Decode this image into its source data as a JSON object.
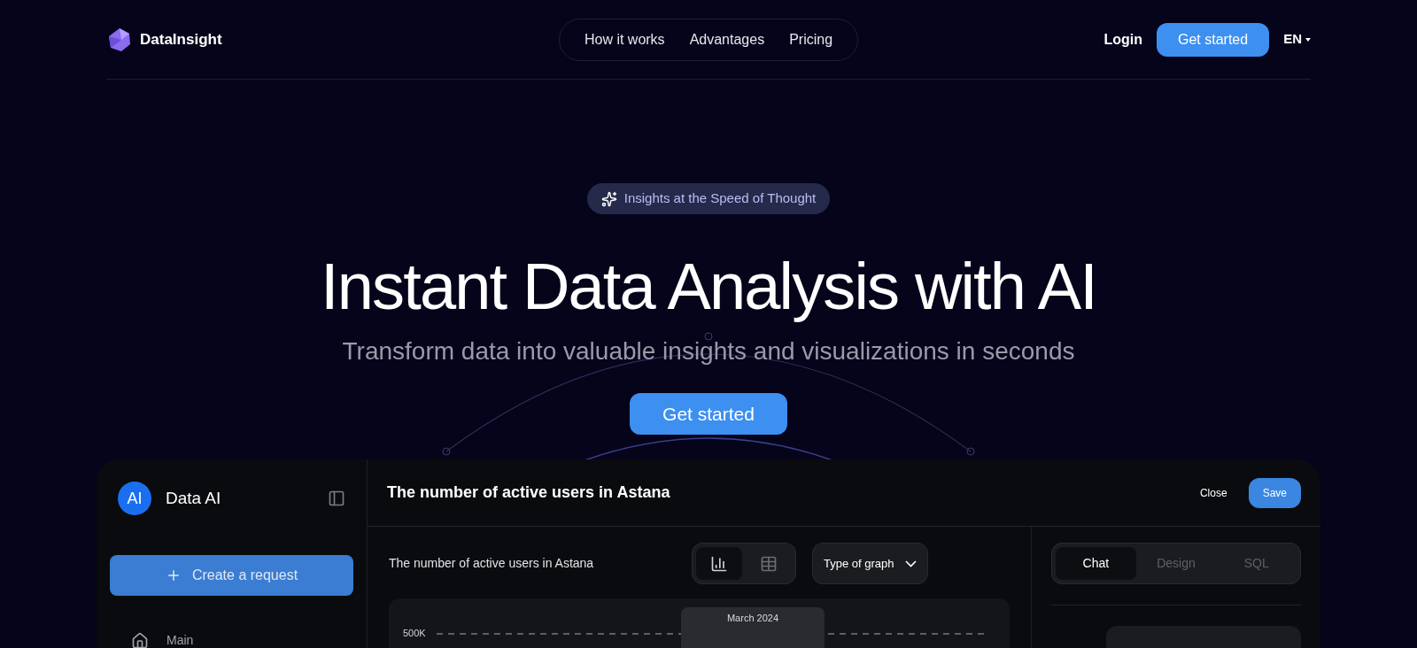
{
  "brand": {
    "name": "DataInsight"
  },
  "nav": {
    "links": [
      {
        "label": "How it works"
      },
      {
        "label": "Advantages"
      },
      {
        "label": "Pricing"
      }
    ],
    "login": "Login",
    "cta": "Get started",
    "language": "EN"
  },
  "hero": {
    "badge": "Insights at the Speed of Thought",
    "title": "Instant Data Analysis with AI",
    "subtitle": "Transform data into valuable insights and visualizations in seconds",
    "cta": "Get started"
  },
  "app": {
    "sidebar": {
      "avatar": "AI",
      "name": "Data AI",
      "create_button": "Create a request",
      "items": [
        {
          "label": "Main",
          "selected": false
        }
      ]
    },
    "header": {
      "title": "The number of active users in Astana",
      "close": "Close",
      "save": "Save"
    },
    "chart_panel": {
      "title": "The number of active users in Astana",
      "view_toggle": [
        {
          "kind": "bars",
          "selected": true
        },
        {
          "kind": "table",
          "selected": false
        }
      ],
      "graph_type": "Type of graph",
      "y_tick": "500K",
      "tooltip": "March 2024"
    },
    "right_tabs": [
      {
        "label": "Chat",
        "selected": true
      },
      {
        "label": "Design",
        "selected": false
      },
      {
        "label": "SQL",
        "selected": false
      }
    ]
  }
}
